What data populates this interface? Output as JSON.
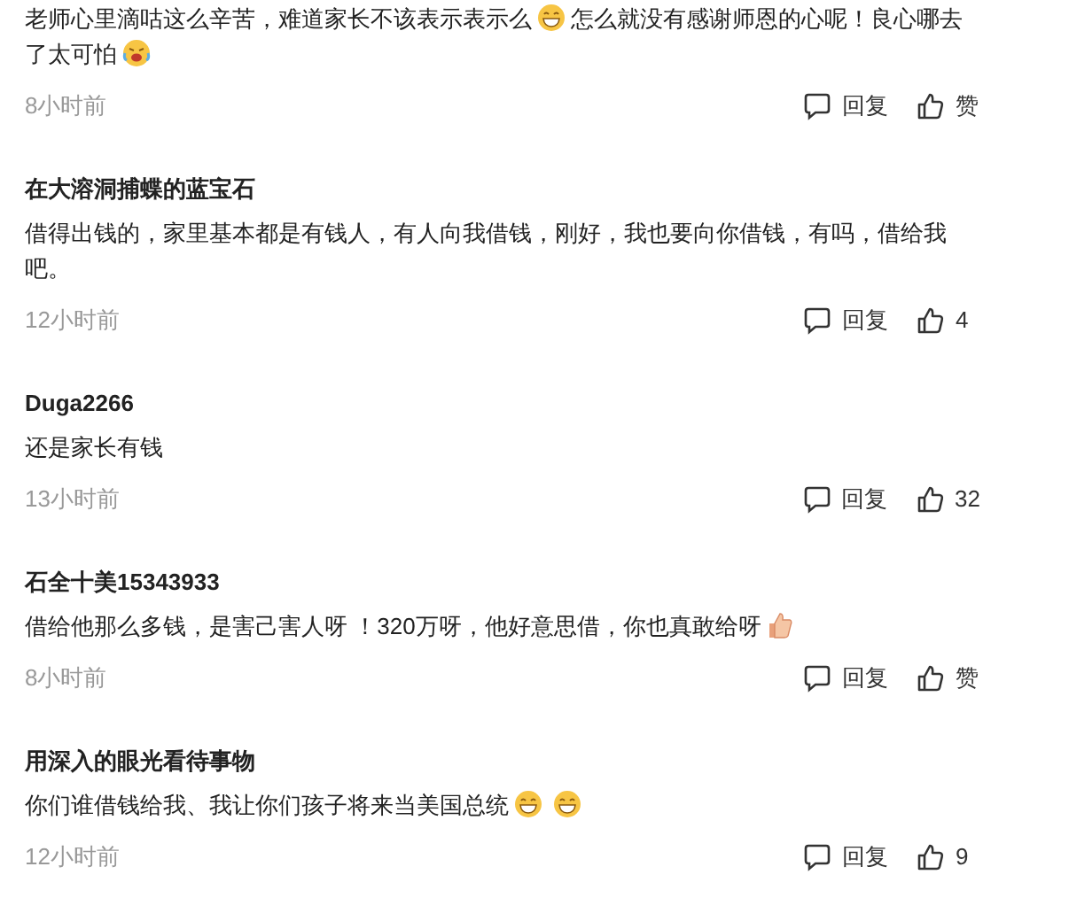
{
  "comments": [
    {
      "parts": [
        {
          "kind": "text",
          "text": "老师心里滴咕这么辛苦，难道家长不该表示表示么"
        },
        {
          "kind": "grin"
        },
        {
          "kind": "text",
          "text": "怎么就没有感谢师恩的心呢！良心哪去了太可怕"
        },
        {
          "kind": "laugh-cry"
        }
      ],
      "time": "8小时前",
      "reply": "回复",
      "like": "赞"
    },
    {
      "author": "在大溶洞捕蝶的蓝宝石",
      "parts": [
        {
          "kind": "text",
          "text": "借得出钱的，家里基本都是有钱人，有人向我借钱，刚好，我也要向你借钱，有吗，借给我吧。"
        }
      ],
      "time": "12小时前",
      "reply": "回复",
      "like": "4"
    },
    {
      "author": "Duga2266",
      "parts": [
        {
          "kind": "text",
          "text": "还是家长有钱"
        }
      ],
      "time": "13小时前",
      "reply": "回复",
      "like": "32"
    },
    {
      "author": "石全十美15343933",
      "parts": [
        {
          "kind": "text",
          "text": "借给他那么多钱，是害己害人呀 ！320万呀，他好意思借，你也真敢给呀"
        },
        {
          "kind": "thumbs"
        }
      ],
      "time": "8小时前",
      "reply": "回复",
      "like": "赞"
    },
    {
      "author": "用深入的眼光看待事物",
      "parts": [
        {
          "kind": "text",
          "text": "你们谁借钱给我、我让你们孩子将来当美国总统"
        },
        {
          "kind": "grin"
        },
        {
          "kind": "grin"
        }
      ],
      "time": "12小时前",
      "reply": "回复",
      "like": "9"
    }
  ]
}
